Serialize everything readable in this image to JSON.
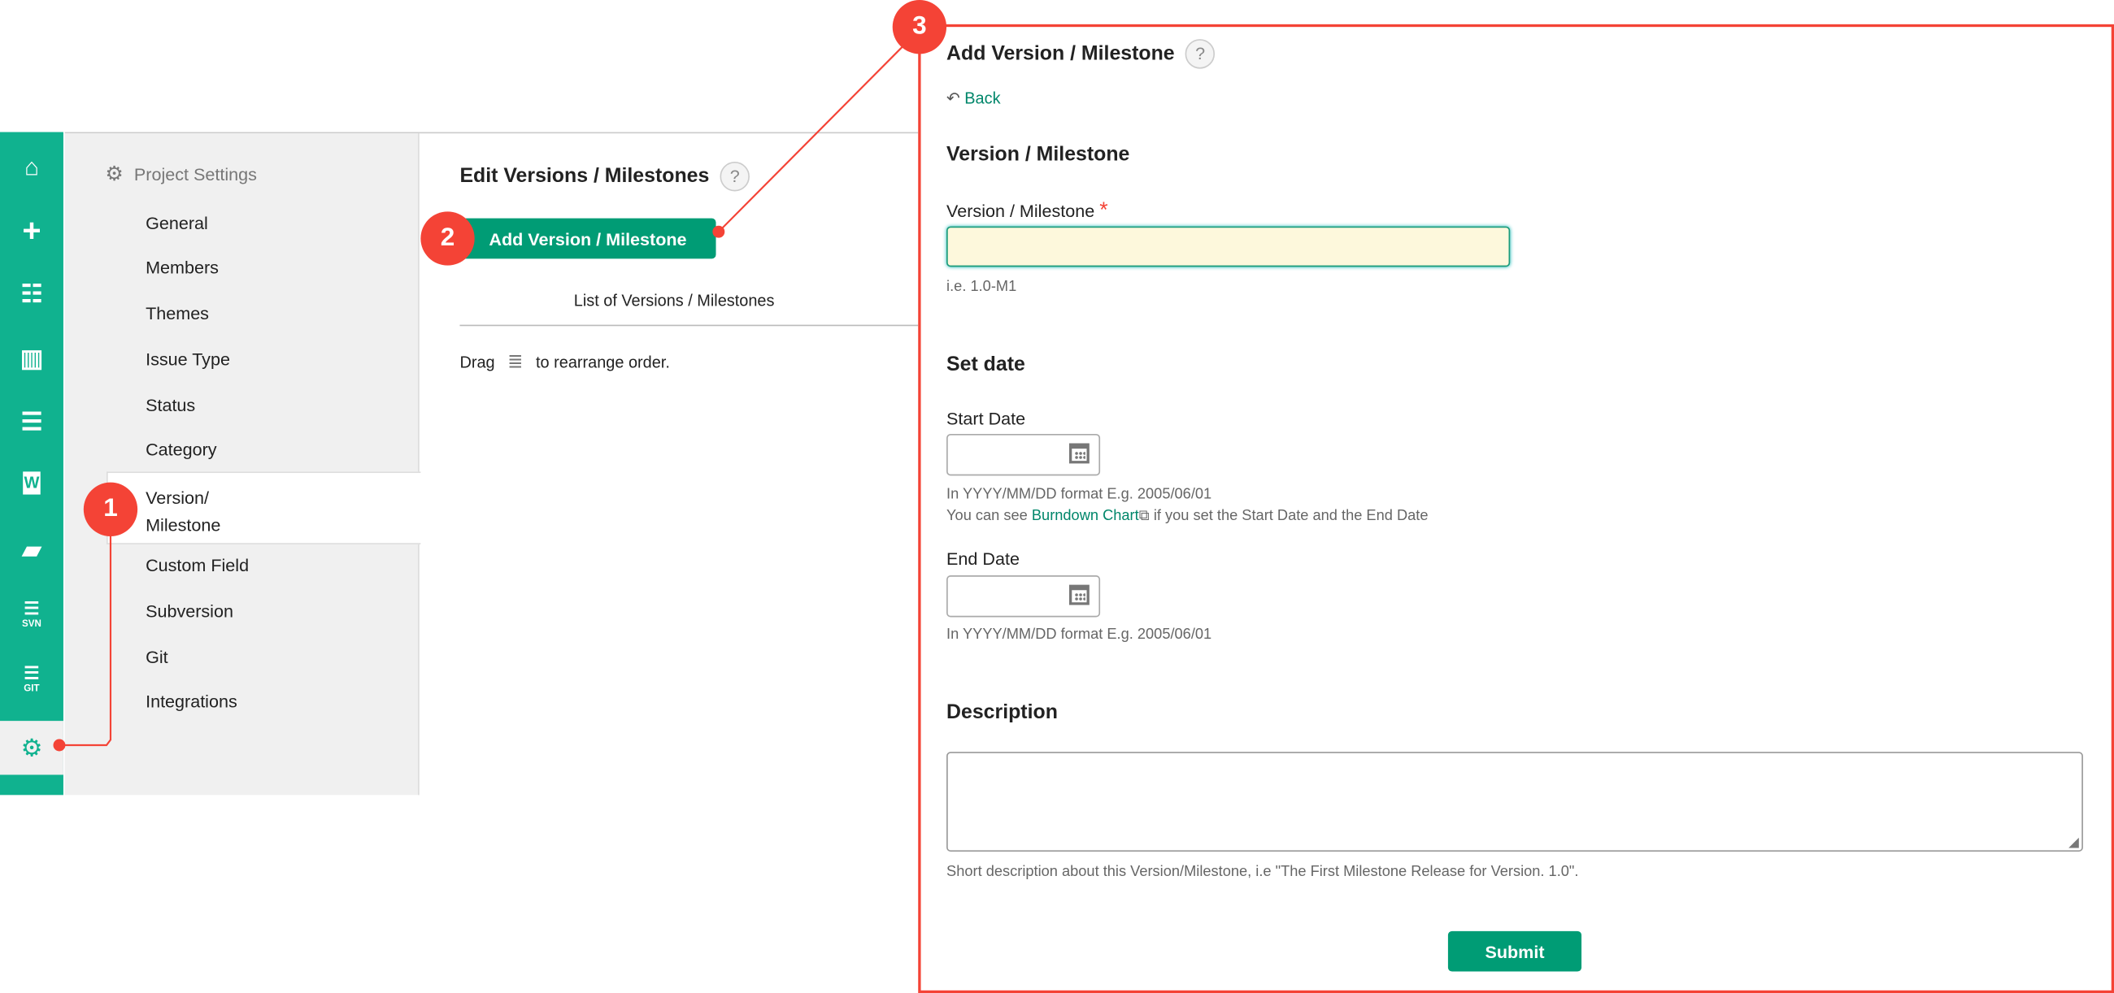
{
  "colors": {
    "brand": "#10b28f",
    "button": "#009c75",
    "annotation": "#f44336",
    "link": "#00866a",
    "required_input_bg": "#fdf8dc"
  },
  "rail": {
    "items": [
      {
        "icon": "home-icon"
      },
      {
        "icon": "plus-icon"
      },
      {
        "icon": "list-icon"
      },
      {
        "icon": "board-icon"
      },
      {
        "icon": "gantt-icon"
      },
      {
        "icon": "wiki-icon"
      },
      {
        "icon": "folder-icon"
      },
      {
        "icon": "svn-icon",
        "label": "SVN"
      },
      {
        "icon": "git-icon",
        "label": "GIT"
      },
      {
        "icon": "gear-icon"
      }
    ]
  },
  "settings": {
    "title": "Project Settings",
    "items": [
      "General",
      "Members",
      "Themes",
      "Issue Type",
      "Status",
      "Category",
      "Version/",
      "Milestone",
      "Custom Field",
      "Subversion",
      "Git",
      "Integrations"
    ]
  },
  "main": {
    "title": "Edit Versions / Milestones",
    "help": "?",
    "add_button": "Add Version / Milestone",
    "list_header": "List of Versions / Milestones",
    "drag_before": "Drag",
    "drag_after": "to rearrange order."
  },
  "annotations": [
    "1",
    "2",
    "3"
  ],
  "form": {
    "title": "Add Version / Milestone",
    "help": "?",
    "back": "Back",
    "section_version": "Version / Milestone",
    "version_label": "Version / Milestone",
    "required_mark": "*",
    "version_value": "",
    "version_hint": "i.e. 1.0-M1",
    "section_date": "Set date",
    "start_label": "Start Date",
    "start_value": "",
    "start_hint": "In YYYY/MM/DD format E.g. 2005/06/01",
    "burndown_before": "You can see",
    "burndown_link": "Burndown Chart",
    "burndown_after": "if you set the Start Date and the End Date",
    "end_label": "End Date",
    "end_value": "",
    "end_hint": "In YYYY/MM/DD format E.g. 2005/06/01",
    "section_description": "Description",
    "description_value": "",
    "description_hint": "Short description about this Version/Milestone, i.e \"The First Milestone Release for Version. 1.0\".",
    "submit": "Submit"
  }
}
